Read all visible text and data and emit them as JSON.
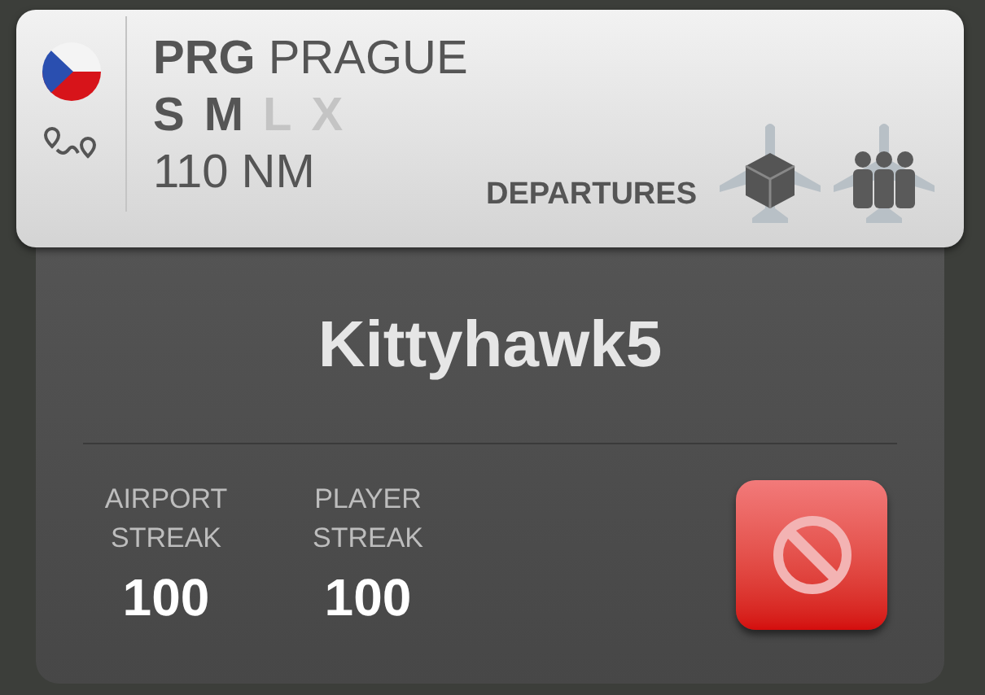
{
  "airport": {
    "code": "PRG",
    "name": "PRAGUE",
    "distance": "110 NM",
    "sizes": [
      {
        "label": "S",
        "enabled": true
      },
      {
        "label": "M",
        "enabled": true
      },
      {
        "label": "L",
        "enabled": false
      },
      {
        "label": "X",
        "enabled": false
      }
    ],
    "departures_label": "DEPARTURES",
    "departures": [
      {
        "kind": "cargo"
      },
      {
        "kind": "passenger"
      }
    ]
  },
  "player": {
    "name": "Kittyhawk5"
  },
  "stats": [
    {
      "label": "AIRPORT STREAK",
      "value": "100"
    },
    {
      "label": "PLAYER STREAK",
      "value": "100"
    }
  ]
}
